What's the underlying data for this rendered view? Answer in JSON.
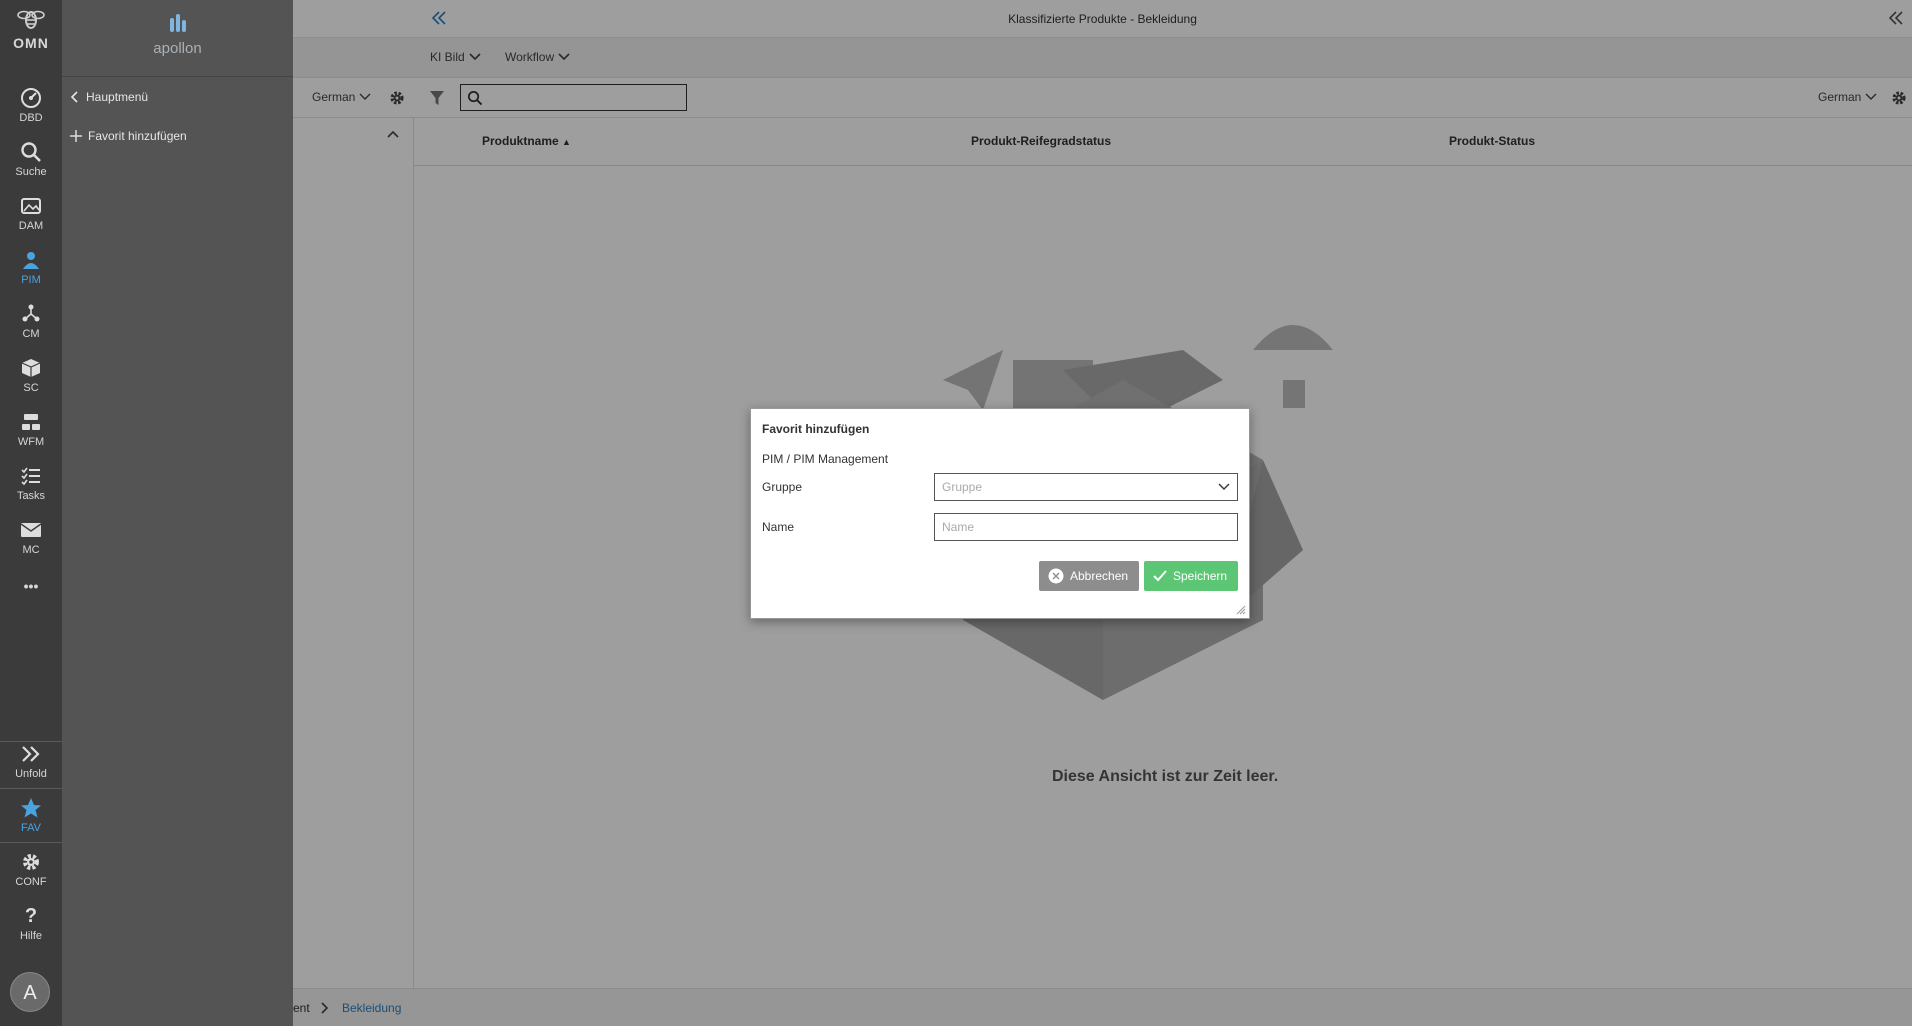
{
  "rail": {
    "logo_text": "OMN",
    "items": [
      {
        "label": "DBD",
        "icon": "dashboard-icon"
      },
      {
        "label": "Suche",
        "icon": "search-icon"
      },
      {
        "label": "DAM",
        "icon": "images-icon"
      },
      {
        "label": "PIM",
        "icon": "pim-icon",
        "active": true
      },
      {
        "label": "CM",
        "icon": "network-icon"
      },
      {
        "label": "SC",
        "icon": "cube-icon"
      },
      {
        "label": "WFM",
        "icon": "workflow-icon"
      },
      {
        "label": "Tasks",
        "icon": "tasks-icon"
      },
      {
        "label": "MC",
        "icon": "mail-icon"
      },
      {
        "label": "•••",
        "icon": "more-icon"
      }
    ],
    "unfold": "Unfold",
    "fav": "FAV",
    "conf": "CONF",
    "help": "Hilfe",
    "avatar": "A",
    "accent_color": "#4aa3df"
  },
  "menu": {
    "brand": "apollon",
    "back": "Hauptmenü",
    "add_favorite": "Favorit hinzufügen"
  },
  "app": {
    "title": "Klassifizierte Produkte - Bekleidung",
    "toolbar": {
      "ki_bild": "KI Bild",
      "workflow": "Workflow"
    },
    "left_language": "German",
    "right_language": "German",
    "columns": [
      "Produktname",
      "Produkt-Reifegradstatus",
      "Produkt-Status"
    ],
    "empty_message": "Diese Ansicht ist zur Zeit leer.",
    "breadcrumb": {
      "prev": "ent",
      "current": "Bekleidung"
    }
  },
  "modal": {
    "title": "Favorit hinzufügen",
    "path": "PIM / PIM Management",
    "group_label": "Gruppe",
    "group_placeholder": "Gruppe",
    "name_label": "Name",
    "name_placeholder": "Name",
    "cancel": "Abbrechen",
    "save": "Speichern",
    "save_color": "#5cc675",
    "cancel_color": "#8d8d8d"
  }
}
